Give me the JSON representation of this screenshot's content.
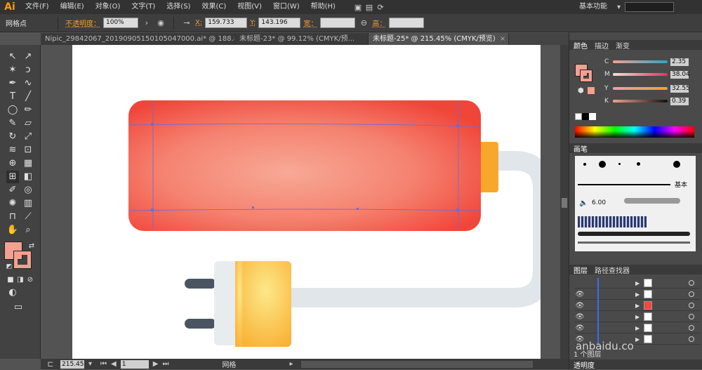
{
  "menubar": {
    "logo": "Ai",
    "items": [
      "文件(F)",
      "编辑(E)",
      "对象(O)",
      "文字(T)",
      "选择(S)",
      "效果(C)",
      "视图(V)",
      "窗口(W)",
      "帮助(H)"
    ],
    "workspace": "基本功能",
    "search_placeholder": ""
  },
  "controlbar": {
    "selection_label": "网格点",
    "opacity_label": "不透明度：",
    "opacity_value": "100%",
    "x_label": "X:",
    "x_value": "159.733",
    "y_label": "Y:",
    "y_value": "143.196",
    "width_label": "宽：",
    "height_label": "高："
  },
  "tabs": [
    {
      "label": "Nipic_29842067_20190905150105047000.ai* @ 188.87% (RGB/预...",
      "close": "×"
    },
    {
      "label": "未标题-23* @ 99.12% (CMYK/预...",
      "close": "×"
    },
    {
      "label": "未标题-25* @ 215.45% (CMYK/预览)",
      "close": "×"
    }
  ],
  "statusbar": {
    "zoom": "215.45",
    "page": "1",
    "mode": "网格"
  },
  "colors": {
    "fill_swatch": "#f4a090",
    "battery_red": "#f04a3a",
    "battery_highlight": "#f7a491",
    "cap_orange": "#f9a72b",
    "cable_gray": "#e1e6ea",
    "plug_yellow": "#fcd85a",
    "plug_body": "#e8ecef",
    "prong_dark": "#4a5561"
  },
  "panels": {
    "color": {
      "tabs": [
        "颜色",
        "描边",
        "渐变"
      ],
      "sliders": [
        {
          "letter": "C",
          "value": "2.35"
        },
        {
          "letter": "M",
          "value": "38.04"
        },
        {
          "letter": "Y",
          "value": "32.55"
        },
        {
          "letter": "K",
          "value": "0.39"
        }
      ]
    },
    "brushes": {
      "tabs": [
        "画笔"
      ],
      "basic_label": "基本",
      "size_value": "6.00"
    },
    "layers": {
      "tabs": [
        "图层",
        "路径查找器"
      ],
      "footer": "1 个图层",
      "rows": 6
    },
    "transparency": {
      "tabs": [
        "透明度"
      ]
    }
  },
  "watermark": "anbaidu.co"
}
